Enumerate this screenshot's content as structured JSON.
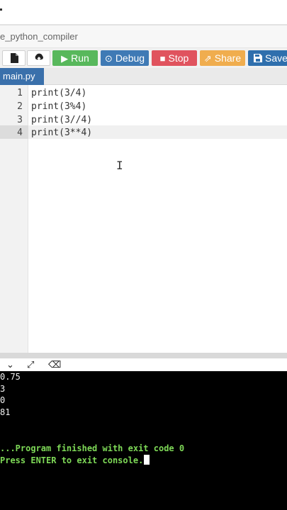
{
  "app": {
    "title": "e_python_compiler"
  },
  "toolbar": {
    "file_icon": "new-file-icon",
    "upload_icon": "upload-icon",
    "run_label": "Run",
    "debug_label": "Debug",
    "stop_label": "Stop",
    "share_label": "Share",
    "save_label": "Save",
    "colors": {
      "run": "#58b85c",
      "debug": "#3f7ab5",
      "stop": "#e0535e",
      "share": "#f0ad4e",
      "save": "#2f6fad"
    }
  },
  "tabs": [
    {
      "label": "main.py",
      "active": true
    }
  ],
  "editor": {
    "active_line": 4,
    "lines": [
      {
        "number": "1",
        "code": "print(3/4)"
      },
      {
        "number": "2",
        "code": "print(3%4)"
      },
      {
        "number": "3",
        "code": "print(3//4)"
      },
      {
        "number": "4",
        "code": "print(3**4)"
      }
    ]
  },
  "console": {
    "toolbar_icons": [
      "chevron-down-icon",
      "expand-icon",
      "clear-icon"
    ],
    "output": [
      "0.75",
      "3",
      "0",
      "81",
      ""
    ],
    "status": "...Program finished with exit code 0",
    "prompt": "Press ENTER to exit console."
  }
}
